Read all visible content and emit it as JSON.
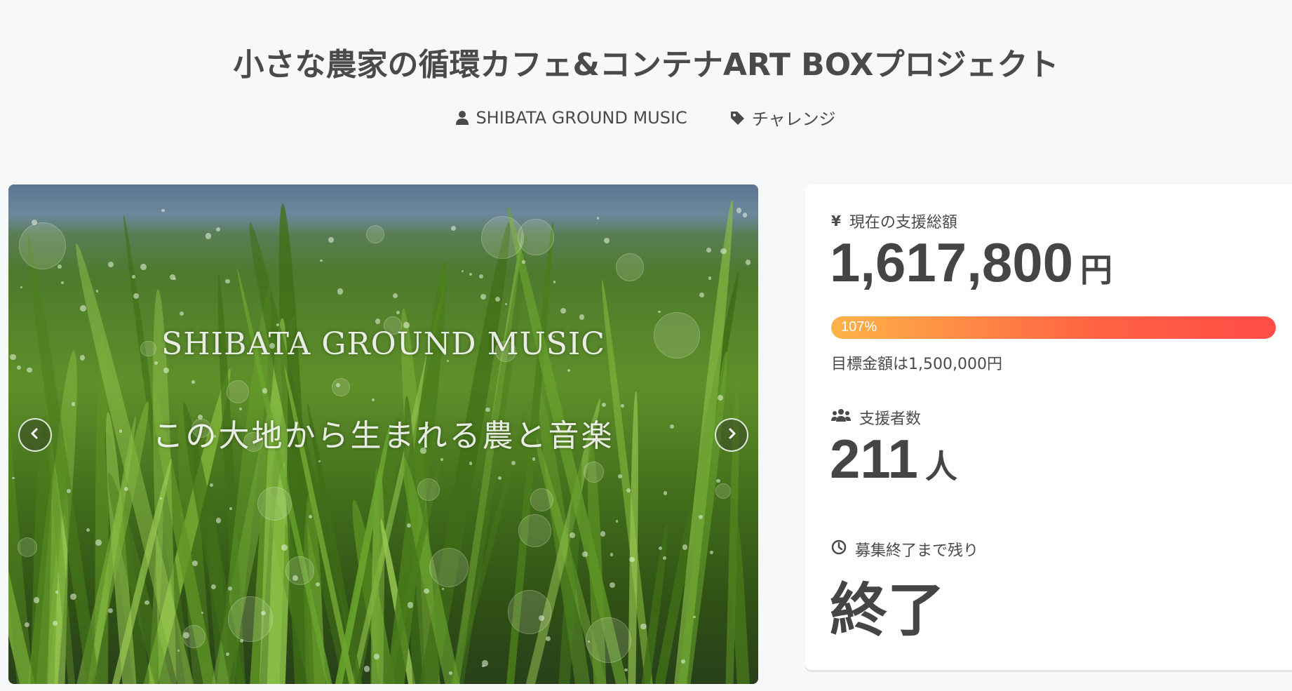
{
  "project": {
    "title": "小さな農家の循環カフェ&コンテナART BOXプロジェクト",
    "owner": "SHIBATA GROUND MUSIC",
    "category": "チャレンジ"
  },
  "hero": {
    "line1": "SHIBATA GROUND MUSIC",
    "line2": "この大地から生まれる農と音楽"
  },
  "stats": {
    "funding_label": "現在の支援総額",
    "funding_amount": "1,617,800",
    "funding_unit": "円",
    "progress_text": "107%",
    "progress_percent": 107,
    "goal_text": "目標金額は1,500,000円",
    "backers_label": "支援者数",
    "backers_count": "211",
    "backers_unit": "人",
    "remaining_label": "募集終了まで残り",
    "remaining_value": "終了"
  },
  "icons": {
    "owner": "user-icon",
    "category": "tag-icon",
    "funding": "yen-icon",
    "backers": "users-icon",
    "remaining": "clock-icon",
    "prev": "chevron-left-icon",
    "next": "chevron-right-icon"
  },
  "colors": {
    "page_bg": "#f7f8fa",
    "text": "#4a4a4a",
    "progress_start": "#fdb347",
    "progress_end": "#ff4c48"
  }
}
